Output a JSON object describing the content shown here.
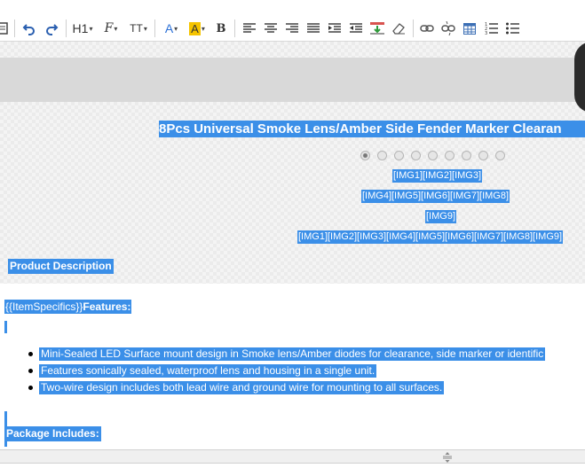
{
  "toolbar": {
    "items": [
      {
        "name": "source-icon"
      },
      {
        "name": "undo-icon"
      },
      {
        "name": "redo-icon"
      },
      {
        "name": "heading",
        "label": "H1"
      },
      {
        "name": "font-family",
        "label": "F"
      },
      {
        "name": "font-size",
        "label": "TT"
      },
      {
        "name": "font-color",
        "label": "A"
      },
      {
        "name": "highlight",
        "label": "A"
      },
      {
        "name": "bold",
        "label": "B"
      }
    ]
  },
  "editor": {
    "title": "8Pcs Universal Smoke Lens/Amber Side Fender Marker Clearan",
    "gallery_dots": 9,
    "img_lines": [
      "[IMG1][IMG2][IMG3]",
      "[IMG4][IMG5][IMG6][IMG7][IMG8]",
      "[IMG9]",
      "[IMG1][IMG2][IMG3][IMG4][IMG5][IMG6][IMG7][IMG8][IMG9]"
    ],
    "product_description": "Product Description",
    "item_specifics": "{{ItemSpecifics}}",
    "features_label": "Features:",
    "features": [
      "Mini-Sealed LED Surface mount design in Smoke lens/Amber diodes for clearance, side marker or identific",
      "Features sonically sealed, waterproof lens and housing in a single unit.",
      "Two-wire design includes both lead wire and ground wire for mounting to all surfaces."
    ],
    "package_label": "Package Includes:"
  },
  "colors": {
    "selection": "#3b8fe8",
    "highlight_yellow": "#f5c400",
    "accent_blue": "#2a6fd6"
  }
}
